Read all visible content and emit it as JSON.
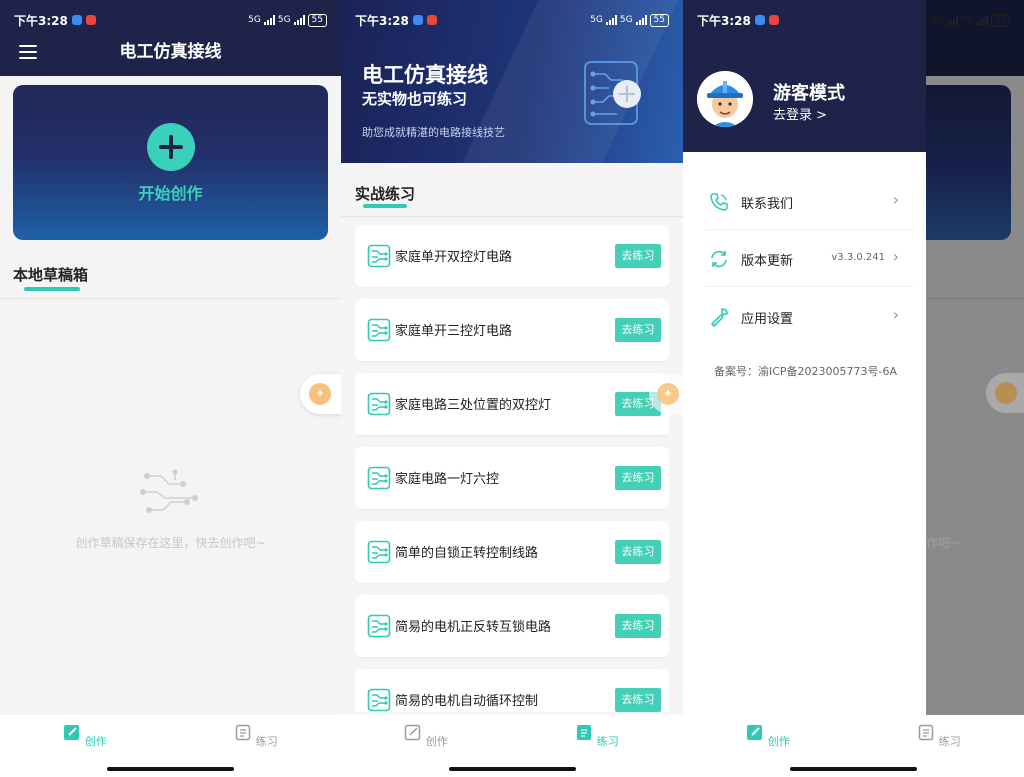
{
  "status": {
    "time": "下午3:28",
    "network": "5G",
    "battery": "55"
  },
  "panel_create": {
    "header_title": "电工仿真接线",
    "create_label": "开始创作",
    "drafts_title": "本地草稿箱",
    "empty_text": "创作草稿保存在这里，快去创作吧~"
  },
  "panel_practice": {
    "banner": {
      "title": "电工仿真接线",
      "subtitle": "无实物也可练习",
      "tagline": "助您成就精湛的电路接线技艺"
    },
    "section_title": "实战练习",
    "practice_label": "去练习",
    "items": [
      {
        "label": "家庭单开双控灯电路"
      },
      {
        "label": "家庭单开三控灯电路"
      },
      {
        "label": "家庭电路三处位置的双控灯"
      },
      {
        "label": "家庭电路一灯六控"
      },
      {
        "label": "简单的自锁正转控制线路"
      },
      {
        "label": "简易的电机正反转互锁电路"
      },
      {
        "label": "简易的电机自动循环控制"
      }
    ]
  },
  "panel_drawer": {
    "guest_title": "游客模式",
    "login_link": "去登录 >",
    "menu": [
      {
        "label": "联系我们",
        "icon": "phone-icon"
      },
      {
        "label": "版本更新",
        "icon": "refresh-icon",
        "value": "v3.3.0.241"
      },
      {
        "label": "应用设置",
        "icon": "wrench-icon"
      }
    ],
    "icp": "备案号：渝ICP备2023005773号-6A",
    "bg_empty_text": "作吧~"
  },
  "tabbar": {
    "create": "创作",
    "practice": "练习"
  },
  "colors": {
    "navy": "#1d2349",
    "accent": "#2ecab4",
    "button": "#43d0b6",
    "inactive": "#9b9b9b"
  }
}
